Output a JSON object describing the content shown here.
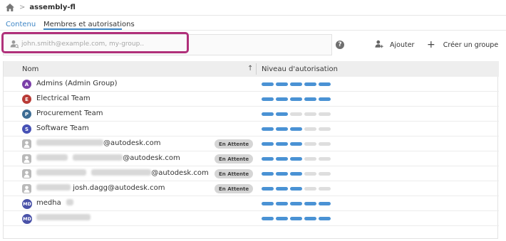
{
  "breadcrumb": {
    "separator": ">",
    "title": "assembly-fl"
  },
  "tabs": [
    {
      "label": "Contenu",
      "active": false
    },
    {
      "label": "Membres et autorisations",
      "active": true
    }
  ],
  "search": {
    "placeholder": "john.smith@example.com, my-group..",
    "value": ""
  },
  "toolbar": {
    "help_label": "?",
    "add_label": "Ajouter",
    "create_group_plus": "+",
    "create_group_label": "Créer un groupe"
  },
  "table": {
    "columns": {
      "name": "Nom",
      "sort_arrow": "↑",
      "level": "Niveau d'autorisation"
    },
    "rows": [
      {
        "avatar": "A",
        "avatar_color": "#7b3fa8",
        "name": "Admins (Admin Group)",
        "pending": false,
        "level": 5
      },
      {
        "avatar": "E",
        "avatar_color": "#b83a36",
        "name": "Electrical Team",
        "pending": false,
        "level": 5
      },
      {
        "avatar": "P",
        "avatar_color": "#3d6c94",
        "name": "Procurement Team",
        "pending": false,
        "level": 2
      },
      {
        "avatar": "S",
        "avatar_color": "#4651b5",
        "name": "Software Team",
        "pending": false,
        "level": 3
      },
      {
        "avatar": "user-icon",
        "name": "@autodesk.com",
        "pending": true,
        "badge": "En Attente",
        "level": 3
      },
      {
        "avatar": "user-icon",
        "name": "@autodesk.com",
        "pending": true,
        "badge": "En Attente",
        "level": 3
      },
      {
        "avatar": "user-icon",
        "name": "@autodesk.com",
        "pending": true,
        "badge": "En Attente",
        "level": 3
      },
      {
        "avatar": "user-icon",
        "name": "josh.dagg@autodesk.com",
        "pending": true,
        "badge": "En Attente",
        "level": 3
      },
      {
        "avatar": "MD",
        "name": "medha",
        "pending": false,
        "level": 5
      },
      {
        "avatar": "MD",
        "name": "",
        "pending": false,
        "level": 5
      }
    ]
  },
  "colors": {
    "accent": "#3e86c6",
    "level_on": "#4a92d4",
    "level_off": "#dedede",
    "highlight": "#b0307a"
  }
}
